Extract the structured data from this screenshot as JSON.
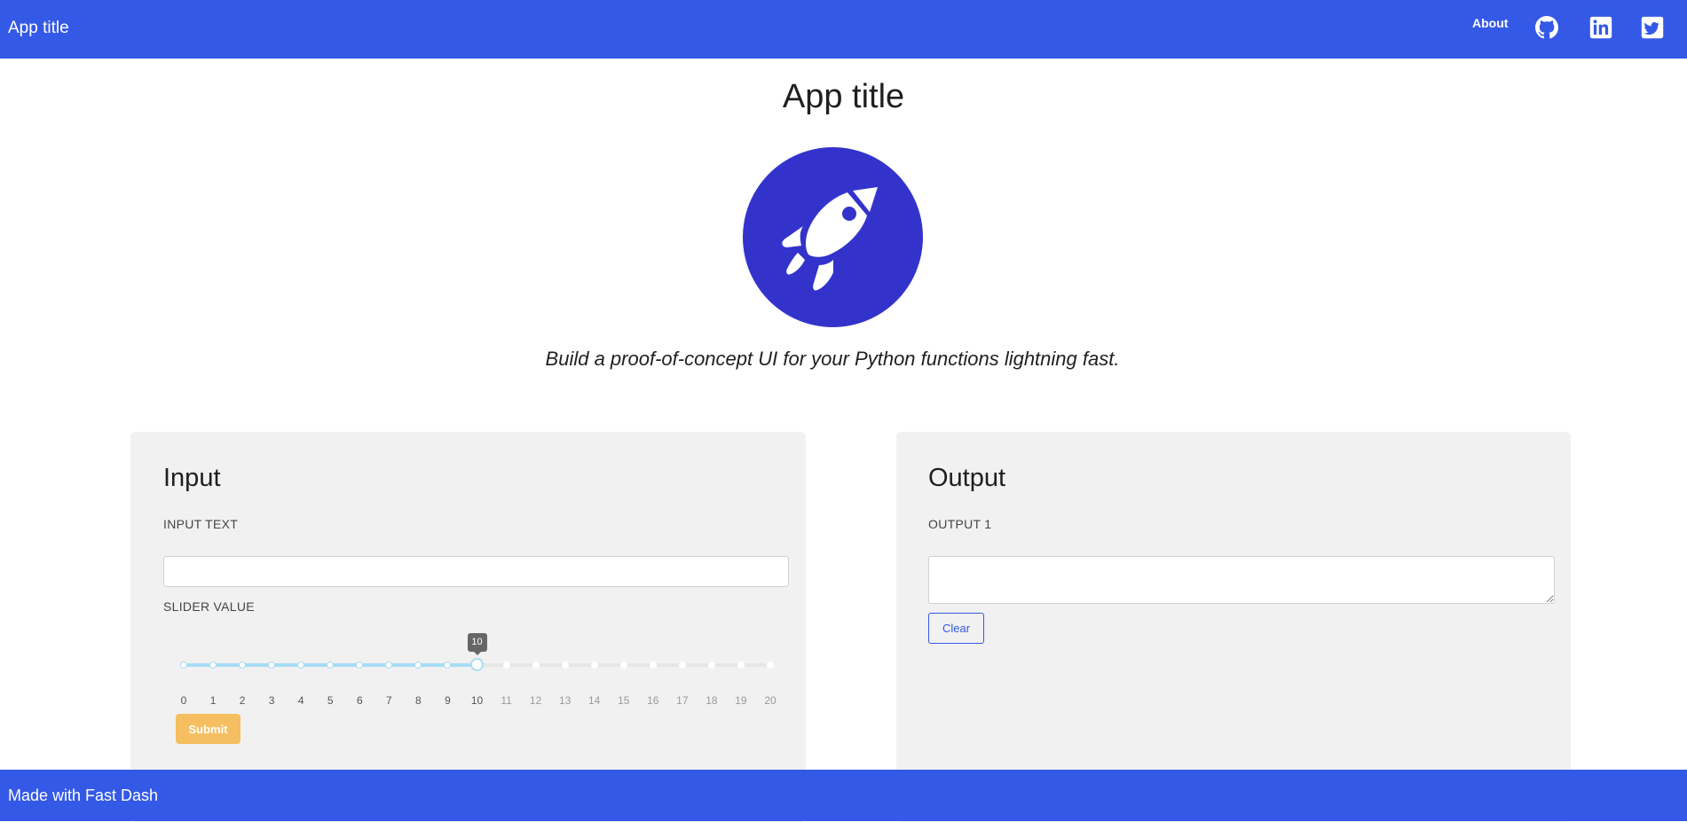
{
  "header": {
    "brand": "App title",
    "nav": {
      "about": "About",
      "icons": [
        "github-icon",
        "linkedin-icon",
        "twitter-icon"
      ]
    },
    "color": "#3459e6"
  },
  "hero": {
    "title": "App title",
    "logo_icon": "rocket-icon",
    "logo_color": "#3333cc",
    "subtitle": "Build a proof-of-concept UI for your Python functions lightning fast."
  },
  "input_card": {
    "title": "Input",
    "text_field": {
      "label": "INPUT TEXT",
      "value": "",
      "placeholder": ""
    },
    "slider": {
      "label": "SLIDER VALUE",
      "min": 0,
      "max": 20,
      "step": 1,
      "value": 10,
      "tooltip": "10",
      "marks": [
        "0",
        "1",
        "2",
        "3",
        "4",
        "5",
        "6",
        "7",
        "8",
        "9",
        "10",
        "11",
        "12",
        "13",
        "14",
        "15",
        "16",
        "17",
        "18",
        "19",
        "20"
      ]
    },
    "submit_label": "Submit"
  },
  "output_card": {
    "title": "Output",
    "output_field": {
      "label": "OUTPUT 1",
      "value": ""
    },
    "clear_label": "Clear"
  },
  "footer": {
    "text": "Made with Fast Dash"
  }
}
